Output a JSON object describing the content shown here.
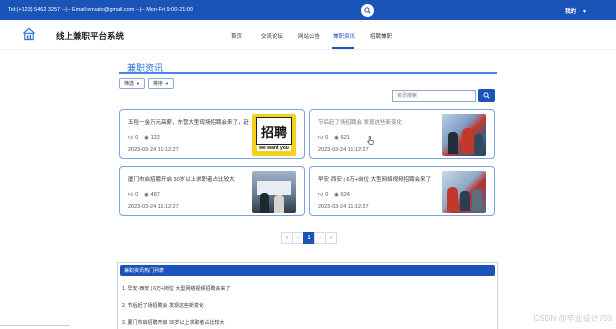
{
  "topbar": {
    "contact": "Tel:(+123) 5462 3257 --|-- Email:envato@gmail.com --|-- Mon-Fri 9:00-21:00",
    "user": "我的"
  },
  "header": {
    "site_title": "线上兼职平台系统",
    "nav": [
      "首页",
      "交流论坛",
      "网站公告",
      "兼职资讯",
      "招聘兼职"
    ],
    "active_nav": "兼职资讯"
  },
  "section": {
    "title": "兼职资讯",
    "filter_label": "筛选",
    "sort_label": "排序",
    "search_placeholder": "资讯搜索"
  },
  "cards": [
    {
      "title": "五险一金万元高薪，东营大型现场招聘会来了，赶",
      "likes": "0",
      "views": "122",
      "date": "2023-03-24 11:12:27",
      "thumb_text_1": "招聘",
      "thumb_text_2": "we want you"
    },
    {
      "title": "节后赶了场招聘会 发现这些新变化",
      "likes": "0",
      "views": "621",
      "date": "2023-03-24 11:12:27"
    },
    {
      "title": "厦门市启招聘开启 30岁以上求职者占比较大",
      "likes": "0",
      "views": "487",
      "date": "2023-03-24 11:12:27"
    },
    {
      "title": "早安·西安 | 6万+岗位 大型网络视频招聘会来了",
      "likes": "0",
      "views": "624",
      "date": "2023-03-24 11:12:27"
    }
  ],
  "pagination": {
    "prev_first": "«",
    "prev": "‹",
    "current": "1",
    "next": "›",
    "next_last": "»"
  },
  "hot_list": {
    "title": "兼职资讯热门列表",
    "items": [
      "1. 早安·西安 | 6万+岗位 大型网络视频招聘会来了",
      "2. 节后赶了场招聘会 发现这些新变化",
      "3. 厦门市启招聘开启 30岁以上求职者占比较大"
    ]
  },
  "watermark": "CSDN @毕业设计703",
  "colors": {
    "primary": "#1b54b8",
    "accent": "#4a86e8",
    "card_border": "#7aa3e0"
  },
  "icons": [
    "search-icon",
    "home-logo-icon",
    "like-icon",
    "view-icon",
    "chevron-down-icon"
  ]
}
